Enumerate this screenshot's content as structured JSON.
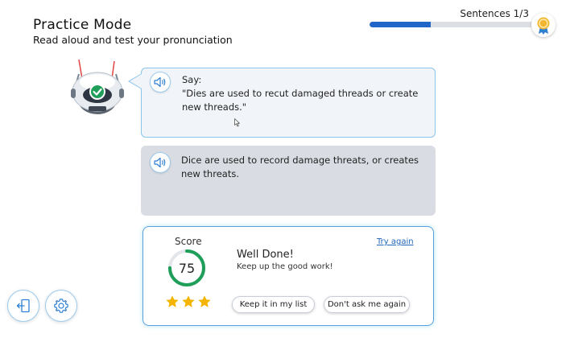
{
  "header": {
    "title": "Practice Mode",
    "subtitle": "Read aloud and test your pronunciation"
  },
  "progress": {
    "label": "Sentences 1/3",
    "current": 1,
    "total": 3,
    "fill_fraction": 0.36,
    "accent": "#1f66c8"
  },
  "prompt": {
    "say_label": "Say:",
    "sentence": "\"Dies are used to recut damaged threads or create new threads.\""
  },
  "response": {
    "transcript": "Dice are used to record damage threats, or creates new threats."
  },
  "result": {
    "score_label": "Score",
    "score": 75,
    "score_fraction": 0.75,
    "stars_earned": 3,
    "stars_total": 3,
    "headline": "Well Done!",
    "message": "Keep up the good work!",
    "try_again_label": "Try again",
    "keep_button_label": "Keep it in my list",
    "dont_ask_button_label": "Don't ask me again",
    "ring_color": "#1f9e5a",
    "star_color": "#f4b400"
  },
  "icons": {
    "speaker": "speaker-icon",
    "exit": "exit-icon",
    "settings": "gear-icon",
    "medal": "medal-icon",
    "robot": "robot-mascot-icon"
  }
}
